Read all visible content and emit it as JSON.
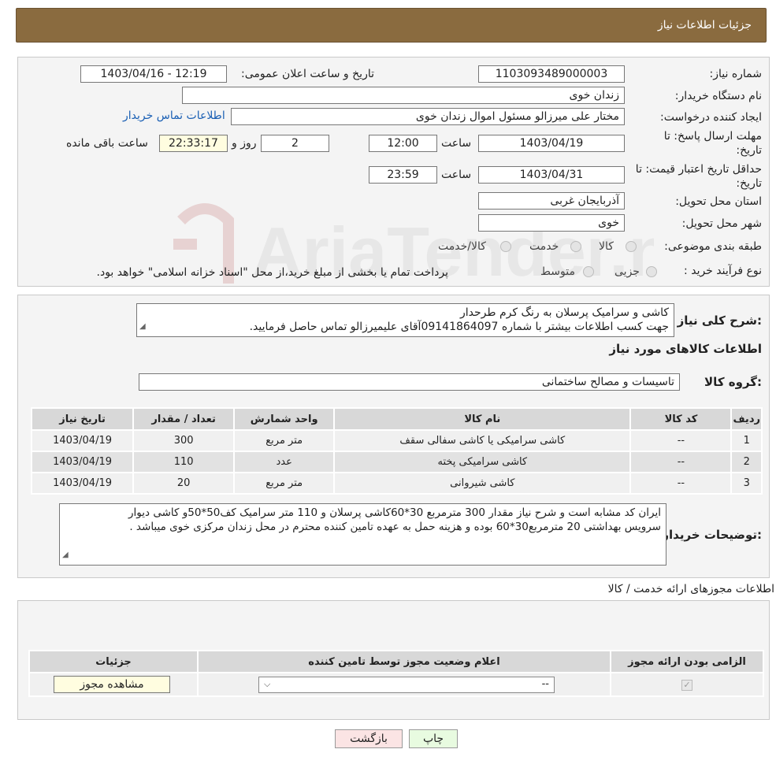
{
  "header": {
    "title": "جزئیات اطلاعات نیاز"
  },
  "watermark": {
    "text": "AriaTender.neT"
  },
  "details": {
    "need_number_label": "شماره نیاز:",
    "need_number": "1103093489000003",
    "announce_label": "تاریخ و ساعت اعلان عمومی:",
    "announce_value": "1403/04/16 - 12:19",
    "buyer_name_label": "نام دستگاه خریدار:",
    "buyer_name": "زندان خوی",
    "requester_label": "ایجاد کننده درخواست:",
    "requester": "مختار علی میرزالو مسئول اموال زندان خوی",
    "contact_link": "اطلاعات تماس خریدار",
    "deadline_label": "مهلت ارسال پاسخ: تا تاریخ:",
    "deadline_date": "1403/04/19",
    "time_label": "ساعت",
    "deadline_time": "12:00",
    "days_value": "2",
    "days_label": "روز و",
    "remaining_time": "22:33:17",
    "remaining_label": "ساعت باقی مانده",
    "validity_label": "حداقل تاریخ اعتبار قیمت: تا تاریخ:",
    "validity_date": "1403/04/31",
    "validity_time": "23:59",
    "province_label": "استان محل تحویل:",
    "province": "آذربایجان غربی",
    "city_label": "شهر محل تحویل:",
    "city": "خوی",
    "category_label": "طبقه بندی موضوعی:",
    "category_options": [
      "کالا",
      "خدمت",
      "کالا/خدمت"
    ],
    "process_label": "نوع فرآیند خرید :",
    "process_options": [
      "جزیی",
      "متوسط"
    ],
    "process_note": "پرداخت تمام یا بخشی از مبلغ خرید،از محل \"اسناد خزانه اسلامی\" خواهد بود."
  },
  "description": {
    "label": "شرح کلی نیاز:",
    "lines": [
      "کاشی و سرامیک پرسلان به رنگ کرم طرحدار",
      "جهت کسب اطلاعات بیشتر با شماره 09141864097آقای علیمیرزالو تماس حاصل فرمایید."
    ]
  },
  "goods": {
    "section_title": "اطلاعات کالاهای مورد نیاز",
    "group_label": "گروه کالا:",
    "group_value": "تاسیسات و مصالح ساختمانی",
    "columns": [
      "ردیف",
      "کد کالا",
      "نام کالا",
      "واحد شمارش",
      "تعداد / مقدار",
      "تاریخ نیاز"
    ],
    "rows": [
      [
        "1",
        "--",
        "کاشی سرامیکی یا کاشی سفالی سقف",
        "متر مربع",
        "300",
        "1403/04/19"
      ],
      [
        "2",
        "--",
        "کاشی سرامیکی پخته",
        "عدد",
        "110",
        "1403/04/19"
      ],
      [
        "3",
        "--",
        "کاشی شیروانی",
        "متر مربع",
        "20",
        "1403/04/19"
      ]
    ]
  },
  "buyer_notes": {
    "label": "توضیحات خریدار:",
    "lines": [
      "ایران کد مشابه است و شرح نیاز مقدار 300 مترمربع 30*60کاشی پرسلان و 110 متر سرامیک کف50*50و کاشی دیوار",
      "سرویس بهداشتی 20 مترمربع30*60 بوده و هزینه حمل به عهده تامین کننده محترم در محل زندان مرکزی خوی میباشد ."
    ]
  },
  "permits": {
    "section_title": "اطلاعات مجوزهای ارائه خدمت / کالا",
    "columns": [
      "الزامی بودن ارائه مجوز",
      "اعلام وضعیت مجوز توسط تامین کننده",
      "جزئیات"
    ],
    "select_value": "--",
    "view_button": "مشاهده مجوز"
  },
  "actions": {
    "print": "چاپ",
    "back": "بازگشت"
  }
}
